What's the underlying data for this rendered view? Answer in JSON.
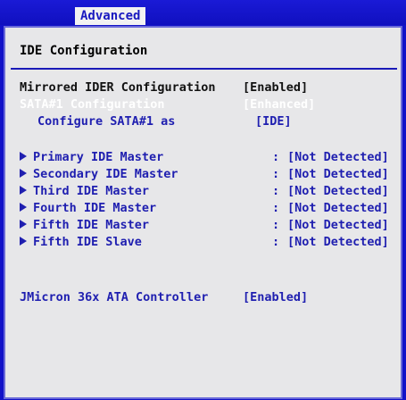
{
  "tabs": {
    "active": "Advanced"
  },
  "panel": {
    "title": "IDE Configuration"
  },
  "settings": {
    "mirrored": {
      "label": "Mirrored IDER Configuration",
      "value": "[Enabled]"
    },
    "sata1": {
      "label": "SATA#1 Configuration",
      "value": "[Enhanced]"
    },
    "sata1_as": {
      "label": "Configure SATA#1 as",
      "value": "[IDE]"
    }
  },
  "ide_devices": [
    {
      "label": "Primary IDE Master",
      "colon": ":",
      "value": "[Not Detected]"
    },
    {
      "label": "Secondary IDE Master",
      "colon": ":",
      "value": "[Not Detected]"
    },
    {
      "label": "Third IDE Master",
      "colon": ":",
      "value": "[Not Detected]"
    },
    {
      "label": "Fourth IDE Master",
      "colon": ":",
      "value": "[Not Detected]"
    },
    {
      "label": "Fifth IDE Master",
      "colon": ":",
      "value": "[Not Detected]"
    },
    {
      "label": "Fifth IDE Slave",
      "colon": ":",
      "value": "[Not Detected]"
    }
  ],
  "jmicron": {
    "label": "JMicron 36x ATA Controller",
    "value": "[Enabled]"
  },
  "colors": {
    "background_blue": "#1212c8",
    "panel_gray": "#e7e7e9",
    "text_blue": "#1f1fb0",
    "highlight_white": "#ffffff"
  }
}
